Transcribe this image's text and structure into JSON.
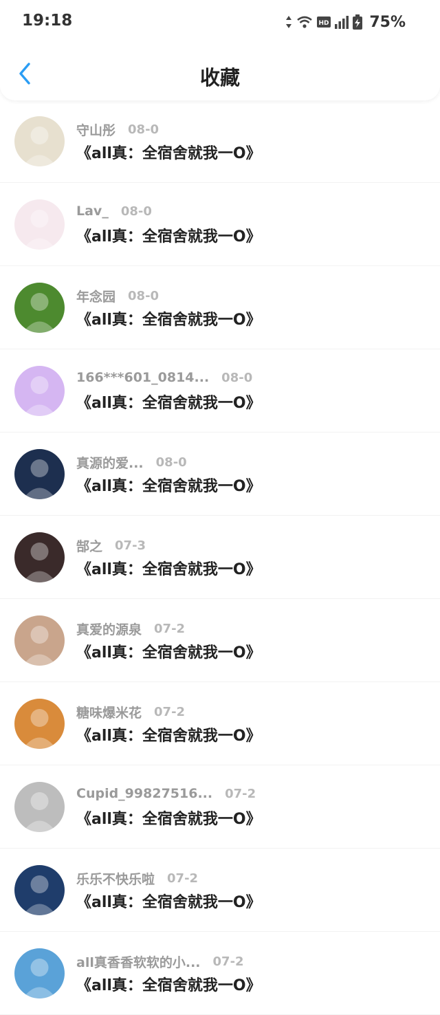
{
  "status_bar": {
    "time": "19:18",
    "battery_percent": "75%"
  },
  "header": {
    "title": "收藏",
    "back_icon": "chevron-left-icon",
    "accent": "#2a9df4"
  },
  "items": [
    {
      "username": "守山彤",
      "date": "08-0",
      "title": "《all真：全宿舍就我一O》",
      "avatar_color": "#e7e0cf"
    },
    {
      "username": "Lav_",
      "date": "08-0",
      "title": "《all真：全宿舍就我一O》",
      "avatar_color": "#f6e9ee"
    },
    {
      "username": "年念园",
      "date": "08-0",
      "title": "《all真：全宿舍就我一O》",
      "avatar_color": "#4d8a2f"
    },
    {
      "username": "166***601_0814...",
      "date": "08-0",
      "title": "《all真：全宿舍就我一O》",
      "avatar_color": "#d5b6f2"
    },
    {
      "username": "真源的爱...",
      "date": "08-0",
      "title": "《all真：全宿舍就我一O》",
      "avatar_color": "#1d2f4f"
    },
    {
      "username": "郜之",
      "date": "07-3",
      "title": "《all真：全宿舍就我一O》",
      "avatar_color": "#3a2a2a"
    },
    {
      "username": "真爱的源泉",
      "date": "07-2",
      "title": "《all真：全宿舍就我一O》",
      "avatar_color": "#c9a58c"
    },
    {
      "username": "糖味爆米花",
      "date": "07-2",
      "title": "《all真：全宿舍就我一O》",
      "avatar_color": "#d98b3b"
    },
    {
      "username": "Cupid_99827516...",
      "date": "07-2",
      "title": "《all真：全宿舍就我一O》",
      "avatar_color": "#bdbdbd"
    },
    {
      "username": "乐乐不快乐啦",
      "date": "07-2",
      "title": "《all真：全宿舍就我一O》",
      "avatar_color": "#1f3d6b"
    },
    {
      "username": "all真香香软软的小...",
      "date": "07-2",
      "title": "《all真：全宿舍就我一O》",
      "avatar_color": "#5aa2d8"
    }
  ]
}
